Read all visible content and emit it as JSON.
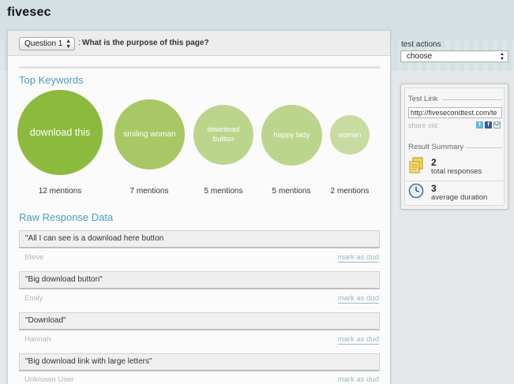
{
  "app": {
    "logo": "fivesec"
  },
  "question": {
    "selected": "Question 1",
    "separator": ":",
    "text": "What is the purpose of this page?"
  },
  "keywords": {
    "title": "Top Keywords",
    "items": [
      {
        "label": "download this",
        "mentions": "12 mentions",
        "color": "#8cba3c"
      },
      {
        "label": "smiling woman",
        "mentions": "7 mentions",
        "color": "#a8c866"
      },
      {
        "label": "download button",
        "mentions": "5 mentions",
        "color": "#bcd58c"
      },
      {
        "label": "happy lady",
        "mentions": "5 mentions",
        "color": "#bcd58c"
      },
      {
        "label": "woman",
        "mentions": "2 mentions",
        "color": "#c8dba1"
      }
    ]
  },
  "responses": {
    "title": "Raw Response Data",
    "mark_label": "mark as dud",
    "items": [
      {
        "text": "\"All I can see is a download here button",
        "user": "Steve"
      },
      {
        "text": "\"Big download button\"",
        "user": "Emily"
      },
      {
        "text": "\"Download\"",
        "user": "Hannah"
      },
      {
        "text": "\"Big download link with large letters\"",
        "user": "Unknown User"
      }
    ]
  },
  "sidebar": {
    "test_actions_label": "test actions",
    "actions_selected": "choose",
    "test_link_heading": "Test Link",
    "test_link_value": "http://fivesecondtest.com/te",
    "share_label": "share via:",
    "share_icons": [
      "twitter-icon",
      "facebook-icon",
      "email-icon"
    ],
    "result_summary_heading": "Result Summary",
    "stats": [
      {
        "value": "2",
        "label": "total responses",
        "icon": "notes-icon"
      },
      {
        "value": "3",
        "label": "average duration",
        "icon": "clock-icon"
      }
    ]
  },
  "colors": {
    "accent": "#4a9bbd",
    "keyword_green": "#8cba3c"
  }
}
